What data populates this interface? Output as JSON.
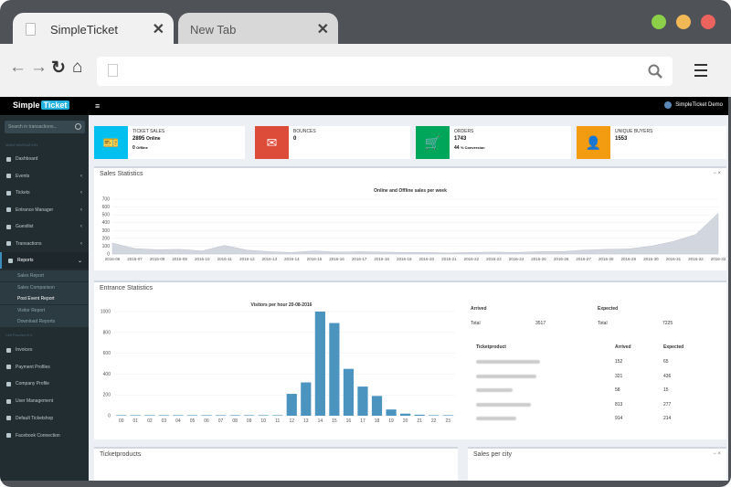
{
  "browser": {
    "tabs": [
      {
        "title": "SimpleTicket"
      },
      {
        "title": "New Tab"
      }
    ],
    "dots": [
      "#8ccf48",
      "#f1b956",
      "#ec625c"
    ]
  },
  "app": {
    "logo_a": "Simple",
    "logo_b": "Ticket",
    "user": "SimpleTicket Demo",
    "search_placeholder": "Search in transactions...",
    "nav_header": "MAIN NAVIGATION",
    "nav_header2": "Cell Puzzles B.V.",
    "nav": [
      {
        "label": "Dashboard"
      },
      {
        "label": "Events",
        "arrow": "‹"
      },
      {
        "label": "Tickets",
        "arrow": "‹"
      },
      {
        "label": "Entrance Manager",
        "arrow": "‹"
      },
      {
        "label": "Guestlist",
        "arrow": "‹"
      },
      {
        "label": "Transactions",
        "arrow": "‹"
      },
      {
        "label": "Reports",
        "arrow": "⌄"
      }
    ],
    "subnav": [
      "Sales Report",
      "Sales Comparison",
      "Post Event Report",
      "Visitor Report",
      "Download Reports"
    ],
    "nav2": [
      "Invoices",
      "Payment Profiles",
      "Company Profile",
      "User Management",
      "Default Ticketshop",
      "Facebook Connection"
    ]
  },
  "info": [
    {
      "title": "TICKET SALES",
      "v1": "2895",
      "v1s": "Online",
      "v2": "0",
      "v2s": "Offline",
      "color": "#00c0ef",
      "icon": "ticket-icon"
    },
    {
      "title": "BOUNCES",
      "v1": "0",
      "color": "#dd4b39",
      "icon": "mail-icon"
    },
    {
      "title": "ORDERS",
      "v1": "1743",
      "v2": "44",
      "v2s": "% Conversion",
      "color": "#00a65a",
      "icon": "cart-icon"
    },
    {
      "title": "UNIQUE BUYERS",
      "v1": "1553",
      "color": "#f39c12",
      "icon": "user-icon"
    }
  ],
  "sales_box": {
    "title": "Sales Statistics",
    "tools": "−  ×"
  },
  "entrance_box": {
    "title": "Entrance Statistics"
  },
  "ticketproducts_box": {
    "title": "Ticketproducts"
  },
  "city_box": {
    "title": "Sales per city",
    "tools": "−  ×"
  },
  "summary": {
    "arrived": "Arrived",
    "expected": "Expected",
    "total": "Total",
    "arrived_total": "3517",
    "expected_total": "7225"
  },
  "product_table": {
    "headers": [
      "Ticketproduct",
      "Arrived",
      "Expected"
    ],
    "rows": [
      {
        "a": "152",
        "e": "65"
      },
      {
        "a": "321",
        "e": "436"
      },
      {
        "a": "58",
        "e": "15"
      },
      {
        "a": "813",
        "e": "277"
      },
      {
        "a": "914",
        "e": "214"
      }
    ]
  },
  "chart_data": [
    {
      "type": "area",
      "title": "Online and Offline sales per week",
      "x": [
        "2016-06",
        "2016-07",
        "2016-08",
        "2016-09",
        "2016-10",
        "2016-11",
        "2016-12",
        "2016-13",
        "2016-14",
        "2016-15",
        "2016-16",
        "2016-17",
        "2016-18",
        "2016-19",
        "2016-20",
        "2016-21",
        "2016-22",
        "2016-23",
        "2016-24",
        "2016-25",
        "2016-26",
        "2016-27",
        "2016-28",
        "2016-29",
        "2016-30",
        "2016-31",
        "2016-32",
        "2016-33"
      ],
      "values": [
        140,
        70,
        55,
        60,
        40,
        110,
        50,
        30,
        20,
        40,
        25,
        30,
        25,
        20,
        20,
        15,
        20,
        25,
        20,
        30,
        30,
        50,
        60,
        65,
        100,
        160,
        250,
        520
      ],
      "yticks": [
        0,
        100,
        200,
        300,
        400,
        500,
        600,
        700
      ],
      "ylim": [
        0,
        700
      ]
    },
    {
      "type": "bar",
      "title": "Visitors per hour 20-08-2016",
      "categories": [
        "00",
        "01",
        "02",
        "03",
        "04",
        "05",
        "06",
        "07",
        "08",
        "09",
        "10",
        "11",
        "12",
        "13",
        "14",
        "15",
        "16",
        "17",
        "18",
        "19",
        "20",
        "21",
        "22",
        "23"
      ],
      "values": [
        5,
        5,
        5,
        5,
        5,
        5,
        5,
        5,
        5,
        5,
        5,
        5,
        210,
        320,
        1000,
        890,
        450,
        280,
        190,
        60,
        20,
        10,
        5,
        5
      ],
      "yticks": [
        0,
        200,
        400,
        600,
        800,
        1000
      ],
      "ylim": [
        0,
        1000
      ]
    }
  ]
}
